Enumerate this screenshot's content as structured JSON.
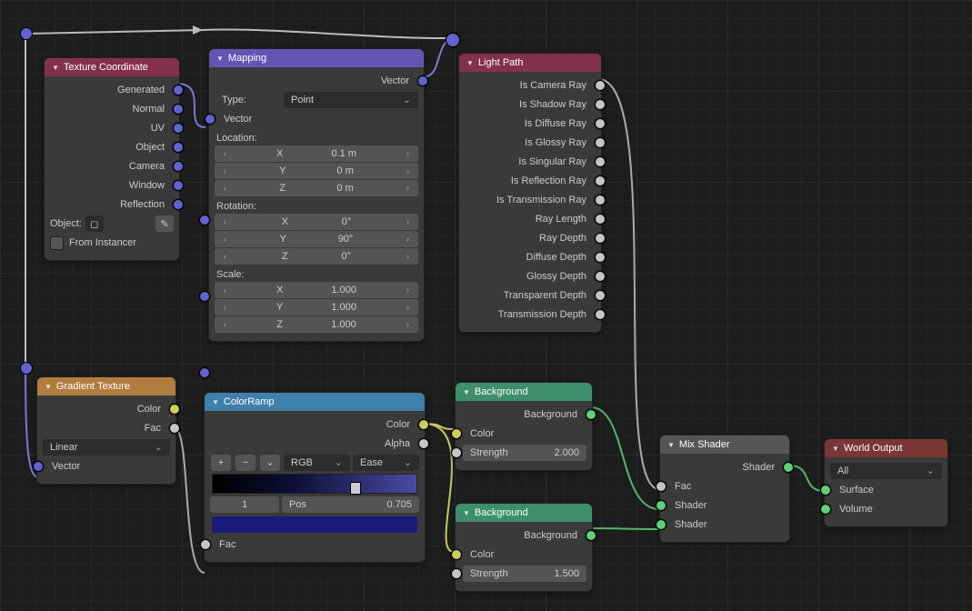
{
  "texCoord": {
    "title": "Texture Coordinate",
    "outputs": [
      "Generated",
      "Normal",
      "UV",
      "Object",
      "Camera",
      "Window",
      "Reflection"
    ],
    "objectLabel": "Object:",
    "fromInstancer": "From Instancer"
  },
  "mapping": {
    "title": "Mapping",
    "vectorOut": "Vector",
    "typeLabel": "Type:",
    "typeValue": "Point",
    "vectorIn": "Vector",
    "location": {
      "label": "Location:",
      "x": {
        "k": "X",
        "v": "0.1 m"
      },
      "y": {
        "k": "Y",
        "v": "0 m"
      },
      "z": {
        "k": "Z",
        "v": "0 m"
      }
    },
    "rotation": {
      "label": "Rotation:",
      "x": {
        "k": "X",
        "v": "0°"
      },
      "y": {
        "k": "Y",
        "v": "90°"
      },
      "z": {
        "k": "Z",
        "v": "0°"
      }
    },
    "scale": {
      "label": "Scale:",
      "x": {
        "k": "X",
        "v": "1.000"
      },
      "y": {
        "k": "Y",
        "v": "1.000"
      },
      "z": {
        "k": "Z",
        "v": "1.000"
      }
    }
  },
  "lightPath": {
    "title": "Light Path",
    "outputs": [
      "Is Camera Ray",
      "Is Shadow Ray",
      "Is Diffuse Ray",
      "Is Glossy Ray",
      "Is Singular Ray",
      "Is Reflection Ray",
      "Is Transmission Ray",
      "Ray Length",
      "Ray Depth",
      "Diffuse Depth",
      "Glossy Depth",
      "Transparent Depth",
      "Transmission Depth"
    ]
  },
  "gradient": {
    "title": "Gradient Texture",
    "colorOut": "Color",
    "facOut": "Fac",
    "mode": "Linear",
    "vectorIn": "Vector"
  },
  "colorRamp": {
    "title": "ColorRamp",
    "colorOut": "Color",
    "alphaOut": "Alpha",
    "colorspace": "RGB",
    "interp": "Ease",
    "index": "1",
    "posLabel": "Pos",
    "posValue": "0.705",
    "facIn": "Fac"
  },
  "bg1": {
    "title": "Background",
    "out": "Background",
    "colorIn": "Color",
    "strengthLabel": "Strength",
    "strengthValue": "2.000"
  },
  "bg2": {
    "title": "Background",
    "out": "Background",
    "colorIn": "Color",
    "strengthLabel": "Strength",
    "strengthValue": "1.500"
  },
  "mix": {
    "title": "Mix Shader",
    "out": "Shader",
    "fac": "Fac",
    "sh1": "Shader",
    "sh2": "Shader"
  },
  "world": {
    "title": "World Output",
    "target": "All",
    "surface": "Surface",
    "volume": "Volume"
  }
}
